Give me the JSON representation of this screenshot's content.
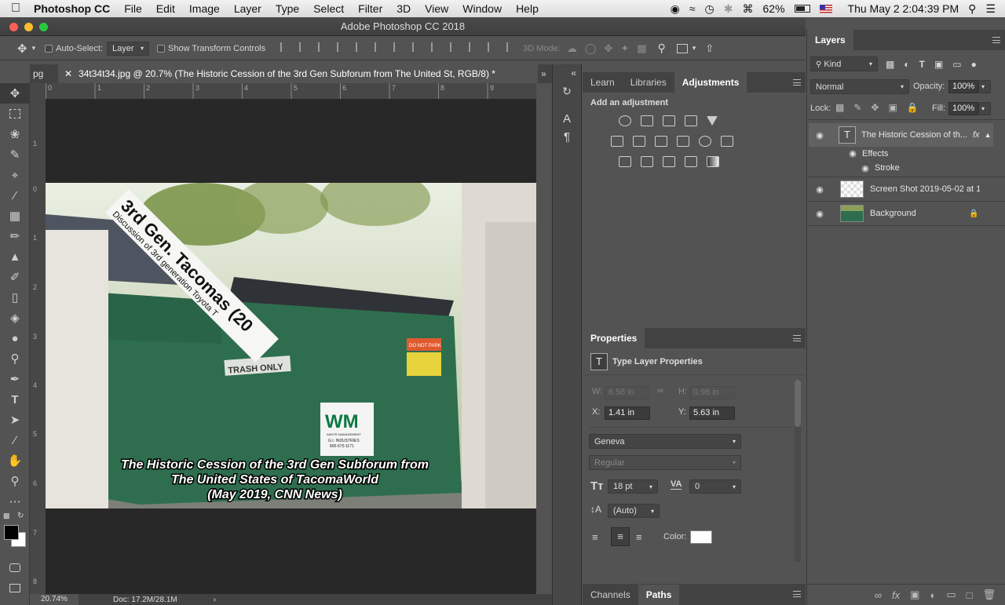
{
  "menubar": {
    "app_name": "Photoshop CC",
    "items": [
      "File",
      "Edit",
      "Image",
      "Layer",
      "Type",
      "Select",
      "Filter",
      "3D",
      "View",
      "Window",
      "Help"
    ],
    "battery": "62%",
    "clock": "Thu May 2  2:04:39 PM"
  },
  "window": {
    "title": "Adobe Photoshop CC 2018"
  },
  "options": {
    "auto_select_label": "Auto-Select:",
    "auto_select_value": "Layer",
    "show_transform_label": "Show Transform Controls",
    "mode3d_label": "3D Mode:"
  },
  "doc_tabs": {
    "partial_tab": "pg",
    "current_tab": "34t34t34.jpg @ 20.7% (The Historic Cession of the 3rd Gen Subforum from The United St, RGB/8) *"
  },
  "rulers": {
    "h_ticks": [
      "0",
      "1",
      "2",
      "3",
      "4",
      "5",
      "6",
      "7",
      "8",
      "9"
    ],
    "v_ticks": [
      "1",
      "0",
      "1",
      "2",
      "3",
      "4",
      "5",
      "6",
      "7",
      "8"
    ]
  },
  "image": {
    "banner_line1": "3rd Gen. Tacomas (20",
    "banner_line2": "Discussion of 3rd generation Toyota T",
    "caption_line1": "The Historic Cession of the 3rd Gen Subforum from",
    "caption_line2": "The United States of TacomaWorld",
    "caption_line3": "(May 2019, CNN News)",
    "trash_label": "TRASH ONLY",
    "do_not_park": "DO NOT PARK",
    "wm_logo": "WM",
    "wm_company": "WASTE MANAGEMENT",
    "wm_industries": "G.I. INDUSTRIES",
    "wm_phone": "800-675-1171"
  },
  "status": {
    "zoom": "20.74%",
    "doc": "Doc: 17.2M/28.1M"
  },
  "adjustments": {
    "tabs": [
      "Learn",
      "Libraries",
      "Adjustments"
    ],
    "heading": "Add an adjustment"
  },
  "properties": {
    "tab": "Properties",
    "title": "Type Layer Properties",
    "w_label": "W:",
    "w_value": "6.56 in",
    "h_label": "H:",
    "h_value": "0.98 in",
    "x_label": "X:",
    "x_value": "1.41 in",
    "y_label": "Y:",
    "y_value": "5.63 in",
    "font_family": "Geneva",
    "font_style": "Regular",
    "font_size": "18 pt",
    "tracking": "0",
    "leading": "(Auto)",
    "color_label": "Color:",
    "text_color": "#ffffff"
  },
  "bottom_tabs": [
    "Channels",
    "Paths"
  ],
  "layers": {
    "tab": "Layers",
    "kind": "Kind",
    "blend_mode": "Normal",
    "opacity_label": "Opacity:",
    "opacity": "100%",
    "lock_label": "Lock:",
    "fill_label": "Fill:",
    "fill": "100%",
    "text_layer": "The Historic Cession of th...",
    "fx": "fx",
    "effects": "Effects",
    "stroke": "Stroke",
    "layer2": "Screen Shot 2019-05-02 at 1...",
    "layer3": "Background"
  },
  "colors": {
    "accent_red": "#fc5f57",
    "accent_yellow": "#fdbc2e",
    "accent_green": "#28c840"
  }
}
